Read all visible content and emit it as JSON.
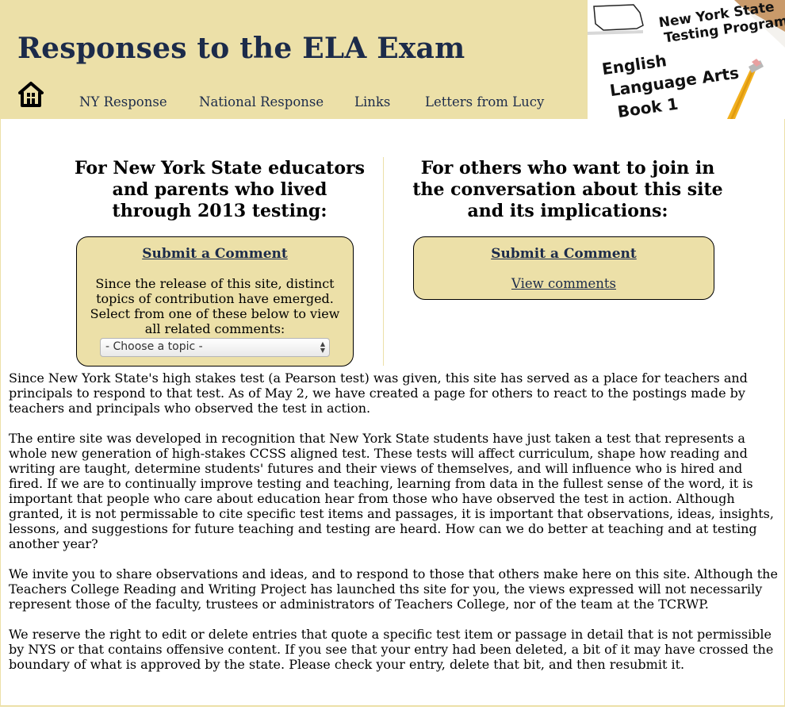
{
  "header": {
    "title": "Responses to the ELA Exam",
    "home_icon": "home-icon",
    "nav": [
      {
        "label": "NY Response"
      },
      {
        "label": "National Response"
      },
      {
        "label": "Links"
      },
      {
        "label": "Letters from Lucy"
      }
    ],
    "banner": {
      "line1": "New York State",
      "line2": "Testing Program",
      "book1": "English",
      "book2": "Language Arts",
      "book3": "Book 1"
    }
  },
  "left_column": {
    "heading": "For New York State educators and parents who lived through 2013 testing:",
    "submit_label": "Submit a Comment",
    "description": "Since the release of this site, distinct topics of contribution have emerged. Select from one of these below to view all related comments:",
    "select_value": "- Choose a topic -"
  },
  "right_column": {
    "heading": "For others who want to join in the conversation about this site and its implications:",
    "submit_label": "Submit a Comment",
    "view_label": "View comments"
  },
  "body": {
    "paragraphs": [
      "Since New York State's high stakes test (a Pearson test) was given, this site has served as a place for teachers and principals to respond to that test. As of May 2, we have created a page for others to react to the postings made by teachers and principals who observed the test in action.",
      "The entire site was developed in recognition that New York State students have just taken a test that represents a whole new generation of high-stakes CCSS aligned test. These tests will affect curriculum, shape how reading and writing are taught, determine students' futures and their views of themselves, and will influence who is hired and fired. If we are to continually improve testing and teaching, learning from data in the fullest sense of the word, it is important that people who care about education hear from those who have observed the test in action. Although granted, it is not permissable to cite specific test items and passages, it is important that observations, ideas, insights, lessons, and suggestions for future teaching and testing are heard. How can we do better at teaching and at testing another year?",
      "We invite you to share observations and ideas, and to respond to those that others make here on this site. Although the Teachers College Reading and Writing Project has launched ths site for you, the views expressed will not necessarily represent those of the faculty, trustees or administrators of Teachers College, nor of the team at the TCRWP.",
      "We reserve the right to edit or delete entries that quote a specific test item or passage in detail that is not permissible by NYS or that contains offensive content. If you see that your entry had been deleted, a bit of it may have crossed the boundary of what is approved by the state. Please check your entry, delete that bit, and then resubmit it."
    ]
  },
  "colors": {
    "header_bg": "#ece0a8",
    "title": "#1c2b4a",
    "link": "#1c2b4a"
  }
}
